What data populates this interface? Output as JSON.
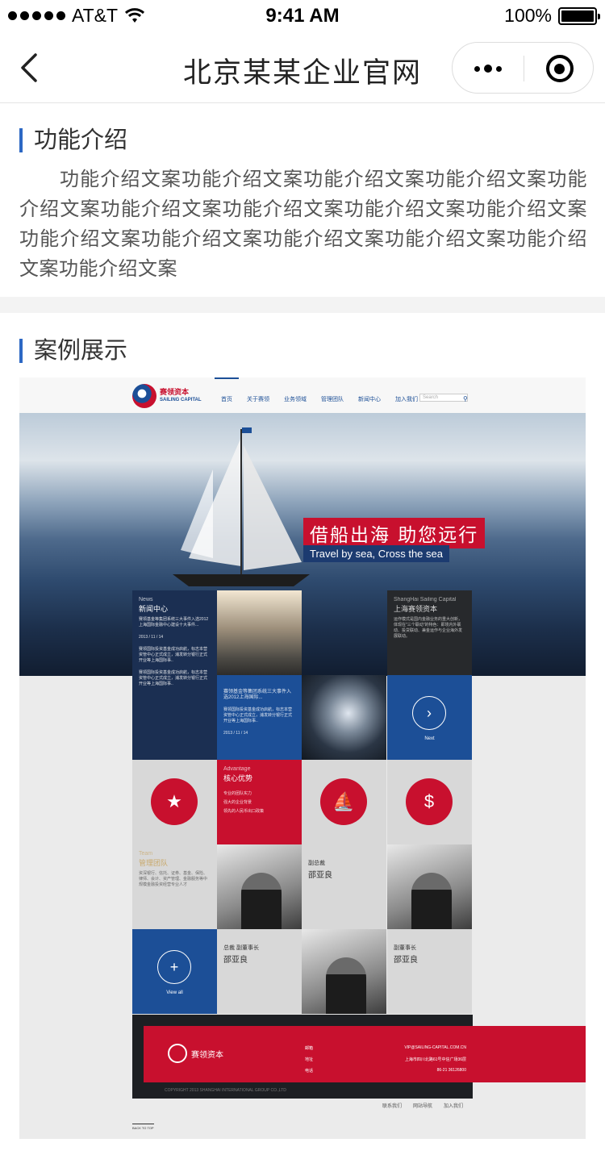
{
  "status_bar": {
    "carrier": "AT&T",
    "time": "9:41 AM",
    "battery": "100%"
  },
  "nav": {
    "title": "北京某某企业官网",
    "back_icon": "chevron-left-icon",
    "more_icon": "more-dots-icon",
    "close_icon": "target-close-icon"
  },
  "intro": {
    "title": "功能介绍",
    "body": "功能介绍文案功能介绍文案功能介绍文案功能介绍文案功能介绍文案功能介绍文案功能介绍文案功能介绍文案功能介绍文案功能介绍文案功能介绍文案功能介绍文案功能介绍文案功能介绍文案功能介绍文案"
  },
  "cases": {
    "title": "案例展示",
    "site": {
      "logo_cn": "赛领资本",
      "logo_en": "SAILING CAPITAL",
      "menu": [
        "首页",
        "关于赛领",
        "业务领域",
        "管理团队",
        "新闻中心",
        "加入我们"
      ],
      "search_placeholder": "Search",
      "banner_cn": "借船出海 助您远行",
      "banner_en": "Travel by sea, Cross the sea",
      "news_en": "News",
      "news_cn": "新闻中心",
      "news_text": "赛领基金等集团系统三大事件入选2012上海国际金融中心建设十大事件...",
      "news_date": "2013 / 11 / 14",
      "news_item2": "赛领国际投资基金成功启航，标志本营资管中心正式成立，浦发转分银行正式开业等上海国际事..",
      "shanghai_en": "ShangHai Sailing Capital",
      "shanghai_cn": "上海赛领资本",
      "shanghai_text": "运作模式是国内金融业务的重大创新，体现在\"三个联动\"的特色：即境内外联动、投贷联动、兼金运作与企业海外发展联动。",
      "mid_news_title": "赛领基金等集团系统三大事件入选2012上海国际...",
      "next_label": "Next",
      "adv_en": "Advantage",
      "adv_cn": "核心优势",
      "adv_items": [
        "专业的团队实力",
        "强大的企业背景",
        "领先的人民币出口政策"
      ],
      "team_en": "Team",
      "team_cn": "管理团队",
      "team_text": "资深银行、信托、证券、基金、保险、律师、会计、资产管理、金融服务等中规模金融投资经营专业人才",
      "vp_title": "副总裁",
      "vp_name": "邵亚良",
      "ceo_title": "总裁  副董事长",
      "ceo_name": "邵亚良",
      "vc_title": "副董事长",
      "vc_name": "邵亚良",
      "view_all": "View all",
      "footer_email_label": "邮箱",
      "footer_email": "VIP@SAILING-CAPITAL.COM.CN",
      "footer_addr_label": "地址",
      "footer_addr": "上海市四川北路61号中信广场36层",
      "footer_tel_label": "电话",
      "footer_tel": "86-21 36126800",
      "copyright": "COPYRIGHT 2013 SHANGHAI INTERNATIONAL GROUP CO.,LTD",
      "bottom_links": [
        "联系我们",
        "网站导航",
        "加入我们"
      ],
      "back_to_top": "BACK TO TOP"
    }
  }
}
